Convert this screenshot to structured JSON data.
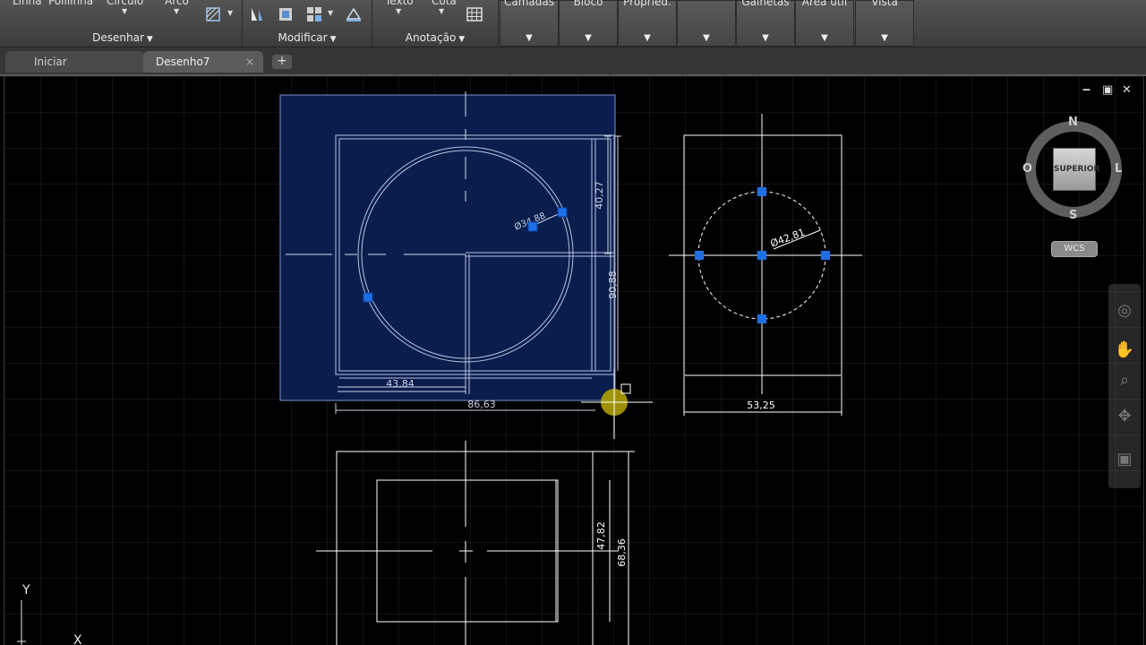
{
  "ribbon": {
    "draw_panel": {
      "title": "Desenhar",
      "tools": [
        "Linha",
        "Polilinha",
        "Círculo",
        "Arco"
      ]
    },
    "modify_panel": {
      "title": "Modificar"
    },
    "annotation_panel": {
      "title": "Anotação",
      "tools": [
        "Texto",
        "Cota"
      ]
    },
    "collapsed_panels": [
      "Camadas",
      "Bloco",
      "Propried.",
      "",
      "Galhetas",
      "Area util",
      "Vista"
    ]
  },
  "tabs": [
    {
      "label": "Iniciar",
      "active": false
    },
    {
      "label": "Desenho7",
      "active": true,
      "close": "×"
    }
  ],
  "tab_add": "+",
  "window_controls": {
    "minimize": "‒",
    "restore": "▣",
    "close": "✕"
  },
  "viewcube": {
    "face": "SUPERIOR",
    "north": "N",
    "south": "S",
    "east": "L",
    "west": "O",
    "wcs": "WCS"
  },
  "drawing": {
    "dimensions": {
      "vertical_40_27": "40,27",
      "vertical_90_88": "90,88",
      "horizontal_43_84": "43,84",
      "horizontal_86_63": "86,63",
      "diameter_tag": "Ø34,88",
      "diameter_42_81": "Ø42,81",
      "horizontal_53_25": "53,25",
      "vertical_47_82": "47,82",
      "vertical_68_36": "68,36"
    },
    "ucs": {
      "y": "Y",
      "x": "X"
    }
  },
  "colors": {
    "grip": "#1e6fe6",
    "selection_fill": "#0a1e4e",
    "grid": "#1c2430",
    "line": "#ffffff"
  }
}
